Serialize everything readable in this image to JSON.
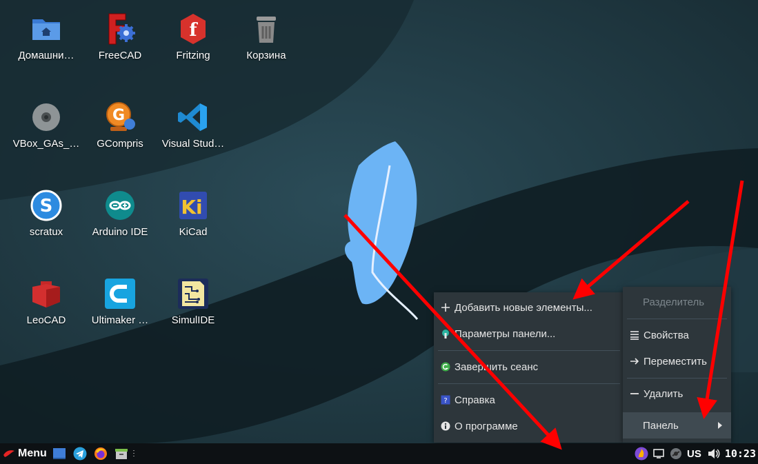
{
  "desktop": {
    "icons": [
      {
        "label": "Домашни…",
        "icon": "home-folder-icon"
      },
      {
        "label": "FreeCAD",
        "icon": "freecad-icon"
      },
      {
        "label": "Fritzing",
        "icon": "fritzing-icon"
      },
      {
        "label": "Корзина",
        "icon": "trash-icon"
      },
      {
        "label": "VBox_GAs_…",
        "icon": "disc-icon"
      },
      {
        "label": "GCompris",
        "icon": "gcompris-icon"
      },
      {
        "label": "Visual Stud…",
        "icon": "vscode-icon"
      },
      {
        "label": "scratux",
        "icon": "scratux-icon"
      },
      {
        "label": "Arduino IDE",
        "icon": "arduino-icon"
      },
      {
        "label": "KiCad",
        "icon": "kicad-icon"
      },
      {
        "label": "LeoCAD",
        "icon": "leocad-icon"
      },
      {
        "label": "Ultimaker …",
        "icon": "cura-icon"
      },
      {
        "label": "SimulIDE",
        "icon": "simulide-icon"
      }
    ]
  },
  "panel_menu": {
    "items": [
      {
        "label": "Добавить новые элементы...",
        "icon": "plus-icon"
      },
      {
        "label": "Параметры панели...",
        "icon": "panel-settings-icon"
      },
      {
        "label": "Завершить сеанс",
        "icon": "logout-icon"
      },
      {
        "label": "Справка",
        "icon": "help-icon"
      },
      {
        "label": "О программе",
        "icon": "info-icon"
      }
    ]
  },
  "item_menu": {
    "items": [
      {
        "label": "Разделитель",
        "icon": "",
        "disabled": true
      },
      {
        "label": "Свойства",
        "icon": "properties-icon"
      },
      {
        "label": "Переместить",
        "icon": "move-arrow-icon"
      },
      {
        "label": "Удалить",
        "icon": "remove-icon"
      },
      {
        "label": "Панель",
        "icon": "",
        "submenu": true
      }
    ]
  },
  "taskbar": {
    "menu_label": "Menu",
    "keyboard_layout": "US",
    "clock": "10:23"
  },
  "colors": {
    "menu_bg": "#2d363b",
    "menu_active": "#3f4a51",
    "arrow": "#ff0000",
    "taskbar_bg": "#0d1114",
    "feather": "#6cb4f5"
  }
}
